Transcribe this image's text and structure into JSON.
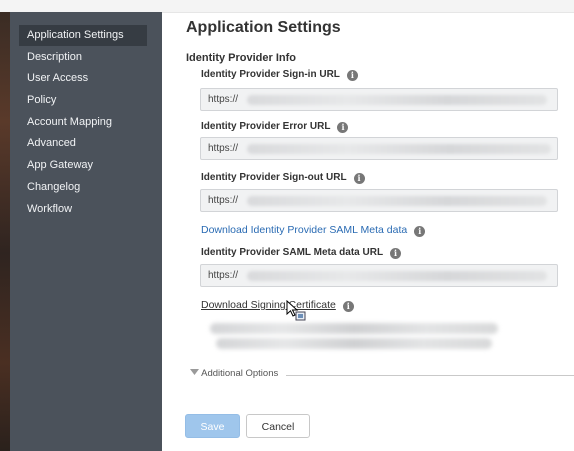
{
  "sidebar": {
    "items": [
      {
        "label": "Application Settings",
        "active": true
      },
      {
        "label": "Description"
      },
      {
        "label": "User Access"
      },
      {
        "label": "Policy"
      },
      {
        "label": "Account Mapping"
      },
      {
        "label": "Advanced"
      },
      {
        "label": "App Gateway"
      },
      {
        "label": "Changelog"
      },
      {
        "label": "Workflow"
      }
    ]
  },
  "main": {
    "title": "Application Settings",
    "section_title": "Identity Provider Info",
    "fields": {
      "signin_label": "Identity Provider Sign-in URL",
      "signin_value": "https://",
      "error_label": "Identity Provider Error URL",
      "error_value": "https://",
      "signout_label": "Identity Provider Sign-out URL",
      "signout_value": "https://",
      "meta_label": "Identity Provider SAML Meta data URL",
      "meta_value": "https://"
    },
    "download_meta_link": "Download Identity Provider SAML Meta data",
    "download_cert_link": "Download Signing Certificate",
    "additional_options": "Additional Options",
    "info_glyph": "i"
  },
  "buttons": {
    "save": "Save",
    "cancel": "Cancel"
  },
  "colors": {
    "sidebar_bg": "#4b525b",
    "sidebar_active": "#363c43",
    "link": "#2a6bb3",
    "save_button": "#9fc6ec"
  }
}
